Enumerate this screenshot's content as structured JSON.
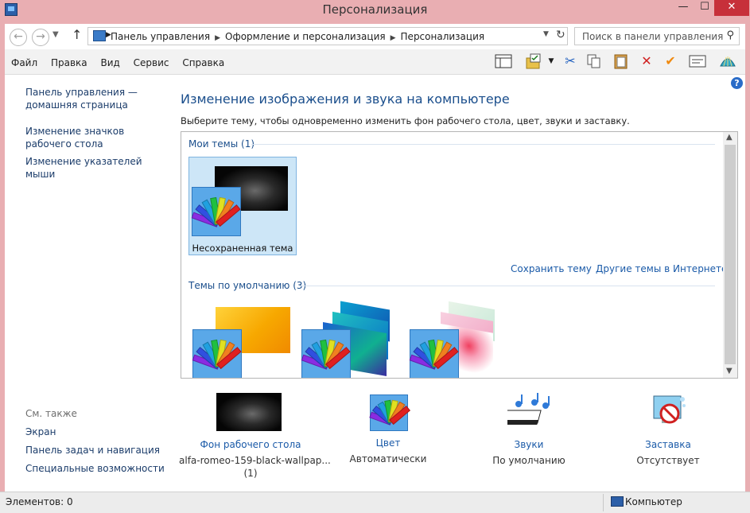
{
  "window": {
    "title": "Персонализация",
    "controls": {
      "minimize": "—",
      "maximize": "☐",
      "close": "✕"
    }
  },
  "address": {
    "breadcrumbs": [
      "Панель управления",
      "Оформление и персонализация",
      "Персонализация"
    ],
    "search_placeholder": "Поиск в панели управления"
  },
  "menu": [
    "Файл",
    "Правка",
    "Вид",
    "Сервис",
    "Справка"
  ],
  "toolbar_icons": [
    "layout-icon",
    "folder-check-icon",
    "dropdown-icon",
    "cut-icon",
    "copy-icon",
    "paste-icon",
    "delete-icon",
    "checkmark-icon",
    "properties-icon",
    "shell-icon"
  ],
  "sidebar": {
    "links": [
      "Панель управления — домашняя страница",
      "Изменение значков рабочего стола",
      "Изменение указателей мыши"
    ],
    "see_also_title": "См. также",
    "see_also": [
      "Экран",
      "Панель задач и навигация",
      "Специальные возможности"
    ]
  },
  "main": {
    "title": "Изменение изображения и звука на компьютере",
    "subtitle": "Выберите тему, чтобы одновременно изменить фон рабочего стола, цвет, звуки и заставку.",
    "my_themes_label": "Мои темы (1)",
    "unsaved_theme": "Несохраненная тема",
    "save_theme": "Сохранить тему",
    "more_themes": "Другие темы в Интернете",
    "default_themes_label": "Темы по умолчанию (3)"
  },
  "settings": [
    {
      "label": "Фон рабочего стола",
      "value": "alfa-romeo-159-black-wallpap...",
      "value2": "(1)"
    },
    {
      "label": "Цвет",
      "value": "Автоматически"
    },
    {
      "label": "Звуки",
      "value": "По умолчанию"
    },
    {
      "label": "Заставка",
      "value": "Отсутствует"
    }
  ],
  "status": {
    "items": "Элементов: 0",
    "location": "Компьютер"
  },
  "colors": {
    "accent": "#1a5aa8",
    "title_bar": "#e9aeb2",
    "selection": "#cde6f7",
    "close_button": "#c7303a"
  }
}
